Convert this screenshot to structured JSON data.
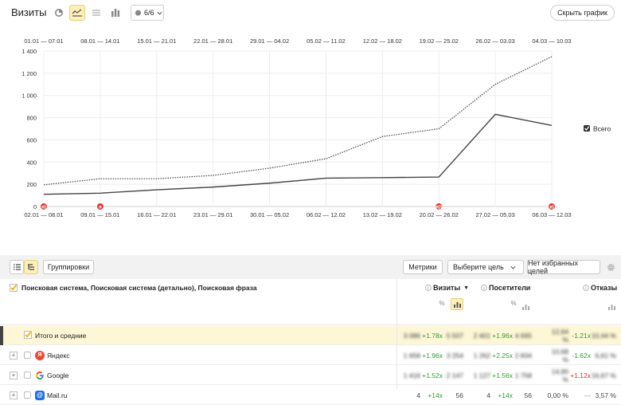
{
  "header": {
    "title": "Визиты",
    "segments_label": "6/6",
    "hide_chart_label": "Скрыть график"
  },
  "legend": {
    "total_label": "Всего"
  },
  "chart_data": {
    "type": "line",
    "x_top_labels": [
      "01.01 — 07.01",
      "08.01 — 14.01",
      "15.01 — 21.01",
      "22.01 — 28.01",
      "29.01 — 04.02",
      "05.02 — 11.02",
      "12.02 — 18.02",
      "19.02 — 25.02",
      "26.02 — 03.03",
      "04.03 — 10.03"
    ],
    "x_bottom_labels": [
      "02.01 — 08.01",
      "09.01 — 15.01",
      "16.01 — 22.01",
      "23.01 — 29.01",
      "30.01 — 05.02",
      "06.02 — 12.02",
      "13.02 — 19.02",
      "20.02 — 26.02",
      "27.02 — 05.03",
      "06.03 — 12.03"
    ],
    "y_ticks": [
      "0",
      "200",
      "400",
      "600",
      "800",
      "1 000",
      "1 200",
      "1 400"
    ],
    "ylim": [
      0,
      1400
    ],
    "grid": true,
    "series": [
      {
        "name": "",
        "style": "solid",
        "values": [
          110,
          120,
          150,
          175,
          210,
          255,
          260,
          265,
          830,
          730
        ]
      },
      {
        "name": "",
        "style": "dotted",
        "values": [
          195,
          250,
          250,
          280,
          345,
          430,
          630,
          700,
          1100,
          1350
        ]
      }
    ],
    "markers": [
      {
        "index": 0,
        "label": "я)"
      },
      {
        "index": 1,
        "label": "я"
      },
      {
        "index": 7,
        "label": "я))"
      },
      {
        "index": 9,
        "label": "я)"
      }
    ]
  },
  "toolbar": {
    "group_label": "Группировки",
    "metrics_label": "Метрики",
    "goal_label": "Выберите цель",
    "favorites_label": "Нет избранных целей"
  },
  "table": {
    "dimension_header": "Поисковая система, Поисковая система (детально), Поисковая фраза",
    "columns": [
      "Визиты",
      "Посетители",
      "Отказы"
    ],
    "total_row": {
      "label": "Итого и средние",
      "cells": [
        "3 086",
        "+1.78x",
        "5 507",
        "2 401",
        "+1.96x",
        "4 695",
        "12,64 %",
        "-1.21x",
        "10,44 %"
      ]
    },
    "rows": [
      {
        "label": "Яндекс",
        "icon": "yandex-icon",
        "cells": [
          "1 658",
          "+1.96x",
          "3 254",
          "1 262",
          "+2.25x",
          "2 834",
          "10,68 %",
          "-1.62x",
          "6,61 %"
        ]
      },
      {
        "label": "Google",
        "icon": "google-icon",
        "cells": [
          "1 416",
          "+1.52x",
          "2 147",
          "1 127",
          "+1.56x",
          "1 758",
          "14,90 %",
          "+1.12x",
          "16,67 %"
        ]
      },
      {
        "label": "Mail.ru",
        "icon": "mailru-icon",
        "cells": [
          "4",
          "+14x",
          "56",
          "4",
          "+14x",
          "56",
          "0,00 %",
          "—",
          "3,57 %"
        ]
      }
    ]
  }
}
